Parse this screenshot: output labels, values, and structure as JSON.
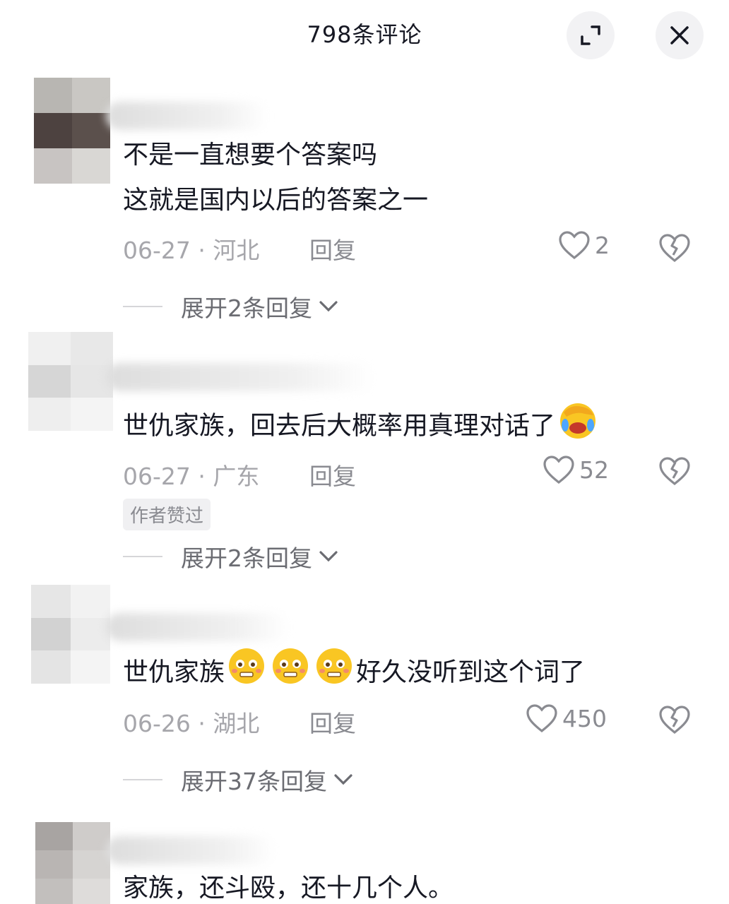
{
  "header": {
    "title": "798条评论"
  },
  "comments": [
    {
      "text_lines": [
        "不是一直想要个答案吗",
        "这就是国内以后的答案之一"
      ],
      "date": "06-27",
      "separator": "·",
      "location": "河北",
      "reply_label": "回复",
      "likes": "2",
      "expand_label": "展开2条回复"
    },
    {
      "text": "世仇家族，回去后大概率用真理对话了",
      "emoji": "face-palm-laughing",
      "date": "06-27",
      "separator": "·",
      "location": "广东",
      "reply_label": "回复",
      "likes": "52",
      "badge": "作者赞过",
      "expand_label": "展开2条回复"
    },
    {
      "text_prefix": "世仇家族",
      "emojis": [
        "pleading-face",
        "pleading-face",
        "pleading-face"
      ],
      "text_suffix": "好久没听到这个词了",
      "date": "06-26",
      "separator": "·",
      "location": "湖北",
      "reply_label": "回复",
      "likes": "450",
      "expand_label": "展开37条回复"
    },
    {
      "text": "家族，还斗殴，还十几个人。"
    }
  ],
  "colors": {
    "accent_text": "#161823",
    "secondary": "#a6a6ab",
    "button_bg": "#f2f2f4"
  }
}
